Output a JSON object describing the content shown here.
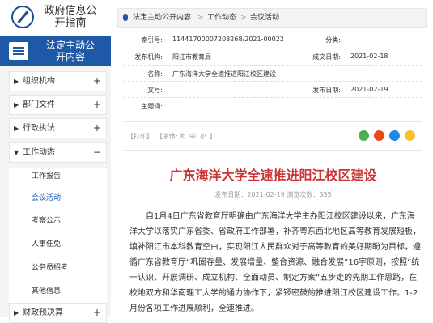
{
  "logo": {
    "title": "政府信息公开指南"
  },
  "section": {
    "title": "法定主动公开内容"
  },
  "menu": [
    {
      "label": "组织机构",
      "sign": "+"
    },
    {
      "label": "部门文件",
      "sign": "+"
    },
    {
      "label": "行政执法",
      "sign": "+"
    },
    {
      "label": "工作动态",
      "sign": "−"
    },
    {
      "label": "财政预决算",
      "sign": "+"
    }
  ],
  "submenu": [
    "工作报告",
    "会议活动",
    "考察公示",
    "人事任免",
    "公务员招考",
    "其他信息"
  ],
  "breadcrumb": {
    "items": [
      "法定主动公开内容",
      "工作动态",
      "会议活动"
    ],
    "sep": ">"
  },
  "meta": {
    "index_label": "索引号:",
    "index_value": "11441700007208268/2021-00022",
    "category_label": "分类:",
    "category_value": "",
    "issuer_label": "发布机构:",
    "issuer_value": "阳江市教育局",
    "created_label": "成文日期:",
    "created_value": "2021-02-18",
    "name_label": "名称:",
    "name_value": "广东海洋大学全速推进阳江校区建设",
    "doc_label": "文号:",
    "doc_value": "",
    "published_label": "发布日期:",
    "published_value": "2021-02-19",
    "topic_label": "主题词:",
    "topic_value": ""
  },
  "toolbar": {
    "print": "【打印】",
    "font": "【字体:",
    "large": "大",
    "medium": "中",
    "small": "小",
    "end": "】"
  },
  "share_colors": [
    "#4caf50",
    "#e64a19",
    "#1e88e5",
    "#fbc02d"
  ],
  "article": {
    "title": "广东海洋大学全速推进阳江校区建设",
    "pub_line": "发布日期：2021-02-19   浏览次数：355",
    "body": "自1月4日广东省教育厅明确由广东海洋大学主办阳江校区建设以来，广东海洋大学以落实广东省委、省政府工作部署，补齐粤东西北地区高等教育发展短板，填补阳江市本科教育空白，实现阳江人民群众对于高等教育的美好期盼为目标，遵循广东省教育厅“巩固存量、发展增量、整合资源、融合发展”16字原则，按照“统一认识、开展调研、成立机构、全面动员、制定方案”五步走的先期工作思路，在校地双方和华南理工大学的通力协作下，紧锣密鼓的推进阳江校区建设工作。1-2月份各项工作进展顺利，全速推进。"
  }
}
